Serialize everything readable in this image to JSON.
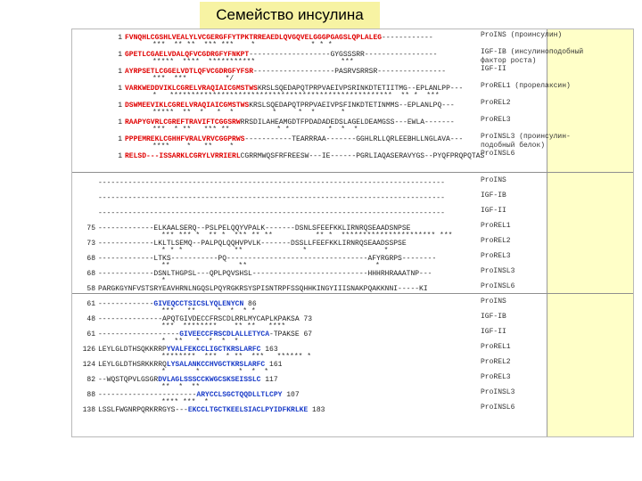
{
  "title": "Семейство инсулина",
  "blocks": [
    {
      "rows": [
        {
          "num": "1",
          "pre": "",
          "red": "FVNQHLCGSHLVEALYLVCGERGFFYTPKTRREAEDLQVGQVELGGGPGAGSLQPLALEG",
          "blk": "------------",
          "label": "ProINS (проинсулин)",
          "cons": "***  ** **  *** ***    *             * * *"
        },
        {
          "num": "1",
          "pre": "",
          "red": "GPETLCGAELVDALQFVCGDRGFYFNKPT",
          "blk": "-------------------GYGSSSRR-----------------",
          "label": "IGF-IB (инсулиноподобный",
          "label2": "фактор роста)",
          "cons": "*****  ****  ***********                    ***"
        },
        {
          "num": "1",
          "pre": "",
          "red": "AYRPSETLCGGELVDTLQFVCGDRGFYFSR",
          "blk": "-------------------PASRVSRRSR----------------",
          "label": "IGF-II",
          "cons": "***  ***         */"
        },
        {
          "num": "1",
          "pre": "",
          "red": "VARKWEDDVIKLCGRELVRAQIAICGMSTWS",
          "blk": "KRSLSQEDAPQTPRPVAEIVPSRINKDTETIITMG--EPLANLPP---",
          "label": "ProREL1 (прорелаксин)",
          "cons": "*   ****************************************************  ** *  ***"
        },
        {
          "num": "1",
          "pre": "",
          "red": "DSWMEEVIKLCGRELVRAQIAICGMSTWS",
          "blk": "KRSLSQEDAPQTPRPVAEIVPSFINKDTETINMMS--EPLANLPQ---",
          "label": "ProREL2",
          "cons": "*****  **  *   *  *         *     *  *      *"
        },
        {
          "num": "1",
          "pre": "",
          "red": "RAAPYGVRLCGREFTRAVIFTCGGSRW",
          "blk": "RRSDILAHEAMGDTFPDADADEDSLAGELDEAMGSS---EWLA-------",
          "label": "ProREL3",
          "cons": "***  * **   *** **           * *         *  *  *"
        },
        {
          "num": "1",
          "pre": "",
          "red": "PPPEMREKLCGHHFVRALVRVCGGPRWS",
          "blk": "-----------TEARRRAA-------GGHLRLLQRLEEBHLLNGLAVA---",
          "label": "ProINSL3 (проинсулин-",
          "label2": "подобный белок)",
          "cons": "****    *   **    *"
        },
        {
          "num": "1",
          "pre": "",
          "red": "RELSD---ISSARKLCGRYLVRRIERL",
          "blk": "CGRRMWQSFRFREESW---IE------PGRLIAQASERAVYGS--PYQFPRQPQTAS",
          "label": "ProINSL6",
          "cons": ""
        }
      ]
    },
    {
      "rows": [
        {
          "num": "",
          "pre": "---------------------------------------------------------------------------------",
          "red": "",
          "blk": "",
          "label": "ProINS",
          "cons": ""
        },
        {
          "num": "",
          "pre": "---------------------------------------------------------------------------------",
          "red": "",
          "blk": "",
          "label": "IGF-IB",
          "cons": ""
        },
        {
          "num": "",
          "pre": "---------------------------------------------------------------------------------",
          "red": "",
          "blk": "",
          "label": "IGF-II",
          "cons": ""
        },
        {
          "num": "75",
          "pre": "-------------ELKAALSERQ--PSLPELQQYVPALK-------DSNLSFEEFKKLIRNRQSEAADSNPSE",
          "red": "",
          "blk": "",
          "label": "ProREL1",
          "cons": "*** *** *  ** *  *** ** **          ** *  ********************** ***"
        },
        {
          "num": "73",
          "pre": "-------------LKLTLSEMQ--PALPQLQQHVPVLK-------DSSLLFEEFKKLIRNRQSEAADSSPSE",
          "red": "",
          "blk": "",
          "label": "ProREL2",
          "cons": "* * *            **              *                  *"
        },
        {
          "num": "68",
          "pre": "-------------LTKS-----------PQ---------------------------------AFYRGRPS--------",
          "red": "",
          "blk": "",
          "label": "ProREL3",
          "cons": "**                **                              *"
        },
        {
          "num": "68",
          "pre": "-------------DSNLTHGPSL---QPLPQVSHSL---------------------------HHHRHRAAATNP---",
          "red": "",
          "blk": "",
          "label": "ProINSL3",
          "cons": "*"
        },
        {
          "num": "58",
          "pre": "PARGKGYNFVSTSRYEAVHRNLNGQSLPQYRGKRSYSPISNTRPFSSQHHKINGYIIISNAKPQAKKNNI-----KI",
          "red": "",
          "blk": "",
          "label": "ProINSL6",
          "cons": ""
        }
      ]
    },
    {
      "rows": [
        {
          "num": "61",
          "pre": "-------------",
          "red": "",
          "blk": "",
          "blue": "GIVEQCCTSICSLYQLENYCN",
          "tail": " 86",
          "label": "ProINS",
          "cons": "***   **     *  *  * *"
        },
        {
          "num": "48",
          "pre": "---------------APQTGIVDECCFRSCDLRRLMYCAPLKPAKSA",
          "red": "",
          "blk": "",
          "blue": "",
          "tail": " 73",
          "label": "IGF-IB",
          "cons": "***  ********    ** **   ****"
        },
        {
          "num": "61",
          "pre": "-------------------",
          "red": "",
          "blk": "",
          "blue": "GIVEECCFRSCDLALLETYCA",
          "tail": "-TPAKSE 67",
          "label": "IGF-II",
          "cons": "*  **   *  *  *  *"
        },
        {
          "num": "126",
          "pre": "LEYLGLDTHSQKKRRP",
          "red": "",
          "blk": "",
          "blue": "YVALFEKCCLIGCTKRSLARFC",
          "tail": " 163",
          "label": "ProREL1",
          "cons": "********  ***  * **  ***   ****** *"
        },
        {
          "num": "124",
          "pre": "LEYLGLDTHSRKKRRQ",
          "red": "",
          "blk": "",
          "blue": "LYSALANKCCHVGCTKRSLARFC",
          "tail": " 161",
          "label": "ProREL2",
          "cons": "*       *         *  *  *"
        },
        {
          "num": "82",
          "pre": "--WQSTQPVLGSGR",
          "red": "",
          "blk": "",
          "blue": "DVLAGLSSSCCKWGCSKSEISSLC",
          "tail": " 117",
          "label": "ProREL3",
          "cons": "**  *  **"
        },
        {
          "num": "88",
          "pre": "-----------------------",
          "red": "",
          "blk": "",
          "blue": "ARYCCLSGCTQQDLLTLCPY",
          "tail": " 107",
          "label": "ProINSL3",
          "cons": "**** ***  *"
        },
        {
          "num": "138",
          "pre": "LSSLFWGNRPQRKRRGYS---",
          "red": "",
          "blk": "",
          "blue": "EKCCLTGCTKEELSIACLPYIDFKRLKE",
          "tail": " 183",
          "label": "ProINSL6",
          "cons": ""
        }
      ]
    }
  ]
}
